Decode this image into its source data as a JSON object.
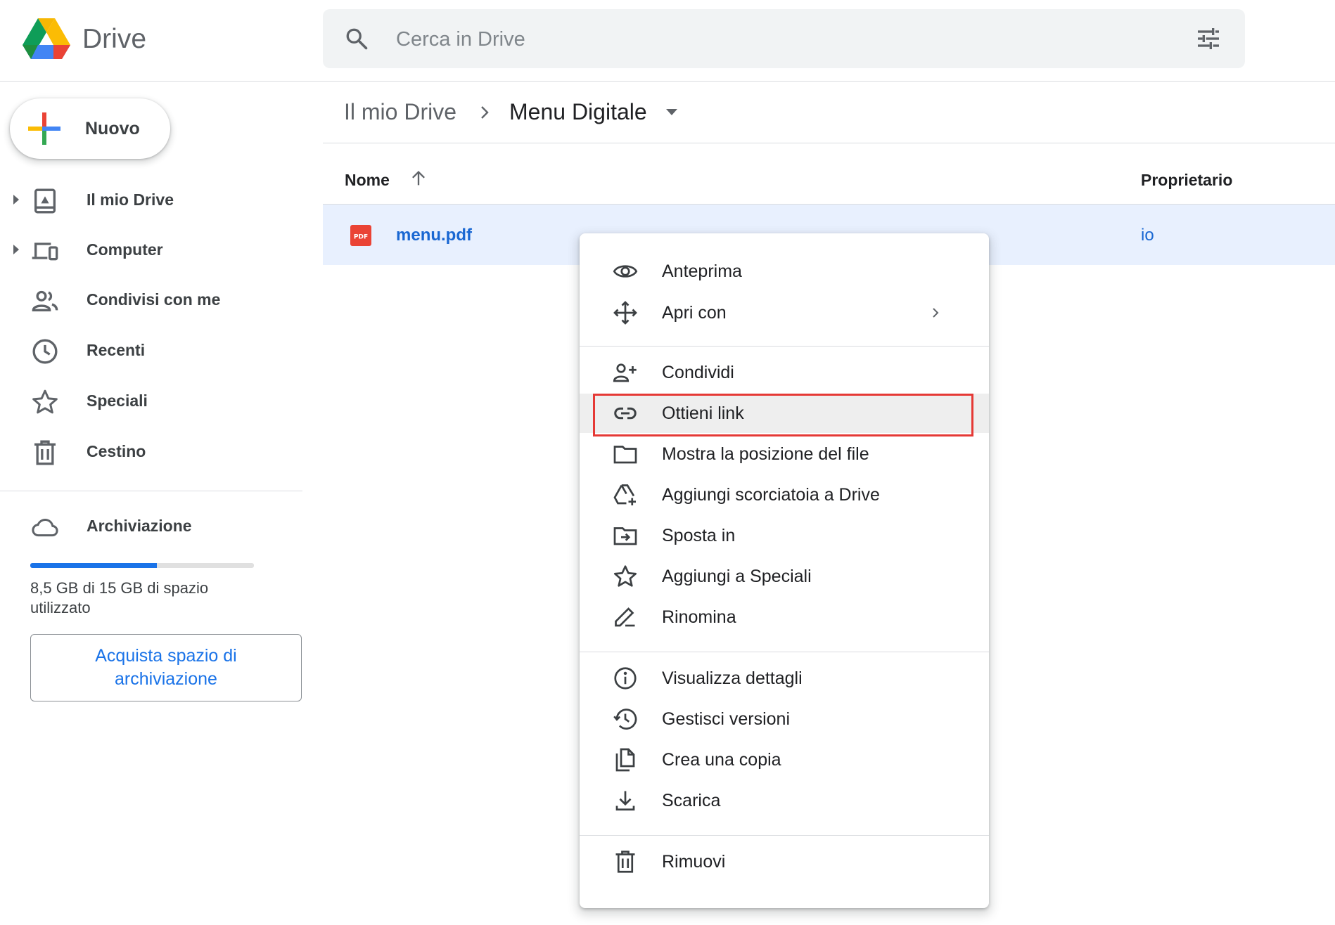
{
  "header": {
    "app_name": "Drive",
    "search_placeholder": "Cerca in Drive"
  },
  "sidebar": {
    "new_label": "Nuovo",
    "items": [
      {
        "label": "Il mio Drive",
        "icon": "my-drive-icon",
        "expandable": true
      },
      {
        "label": "Computer",
        "icon": "computer-icon",
        "expandable": true
      },
      {
        "label": "Condivisi con me",
        "icon": "shared-icon",
        "expandable": false
      },
      {
        "label": "Recenti",
        "icon": "clock-icon",
        "expandable": false
      },
      {
        "label": "Speciali",
        "icon": "star-icon",
        "expandable": false
      },
      {
        "label": "Cestino",
        "icon": "trash-icon",
        "expandable": false
      }
    ],
    "storage": {
      "label": "Archiviazione",
      "usage_text": "8,5 GB di 15 GB di spazio utilizzato",
      "used_fraction": 0.567,
      "buy_label": "Acquista spazio di archiviazione"
    }
  },
  "breadcrumb": {
    "root": "Il mio Drive",
    "current": "Menu Digitale"
  },
  "table": {
    "columns": {
      "name": "Nome",
      "owner": "Proprietario"
    },
    "rows": [
      {
        "name": "menu.pdf",
        "owner": "io",
        "type": "pdf",
        "type_badge": "PDF",
        "selected": true
      }
    ]
  },
  "context_menu": {
    "items": [
      {
        "label": "Anteprima",
        "icon": "eye-icon"
      },
      {
        "label": "Apri con",
        "icon": "move-arrows-icon",
        "submenu": true
      },
      {
        "label": "Condividi",
        "icon": "person-add-icon"
      },
      {
        "label": "Ottieni link",
        "icon": "link-icon",
        "highlighted": true
      },
      {
        "label": "Mostra la posizione del file",
        "icon": "folder-icon"
      },
      {
        "label": "Aggiungi scorciatoia a Drive",
        "icon": "drive-shortcut-icon"
      },
      {
        "label": "Sposta in",
        "icon": "move-to-folder-icon"
      },
      {
        "label": "Aggiungi a Speciali",
        "icon": "star-icon"
      },
      {
        "label": "Rinomina",
        "icon": "pencil-icon"
      },
      {
        "label": "Visualizza dettagli",
        "icon": "info-icon"
      },
      {
        "label": "Gestisci versioni",
        "icon": "history-icon"
      },
      {
        "label": "Crea una copia",
        "icon": "copy-icon"
      },
      {
        "label": "Scarica",
        "icon": "download-icon"
      },
      {
        "label": "Rimuovi",
        "icon": "trash-icon"
      }
    ]
  },
  "colors": {
    "accent": "#1a73e8",
    "selected_row": "#e8f0fe",
    "highlight_box": "#e53935",
    "pdf_red": "#ea4335"
  }
}
